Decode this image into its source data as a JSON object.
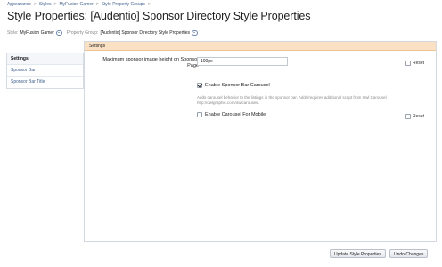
{
  "breadcrumbs": [
    "Appearance",
    "Styles",
    "MyFusion Gamer",
    "Style Property Groups"
  ],
  "breadcrumb_separator": ">",
  "title": "Style Properties: [Audentio] Sponsor Directory Style Properties",
  "filters": {
    "style_label": "Style:",
    "style_value": "MyFusion Gamer",
    "group_label": "Property Group:",
    "group_value": "[Audentio] Sponsor Directory Style Properties"
  },
  "sidebar": {
    "items": [
      {
        "label": "Settings",
        "active": true
      },
      {
        "label": "Sponsor Bar",
        "active": false
      },
      {
        "label": "Sponsor Bar Title",
        "active": false
      }
    ]
  },
  "panel": {
    "header": "Settings",
    "max_height": {
      "label": "Maximum sponsor image height on Sponsor Page",
      "value": "100px",
      "reset_label": "Reset",
      "reset_checked": false
    },
    "carousel": {
      "label": "Enable Sponsor Bar Carousel",
      "checked": true,
      "explain": "Adds carousel behavior to the listings in the sponsor bar. Adds/requires additional script from Owl Carousel http://owlgraphic.com/owlcarousel/."
    },
    "carousel_mobile": {
      "label": "Enable Carousel For Mobile",
      "checked": false,
      "reset_label": "Reset",
      "reset_checked": false
    }
  },
  "buttons": {
    "update": "Update Style Properties",
    "undo": "Undo Changes"
  }
}
